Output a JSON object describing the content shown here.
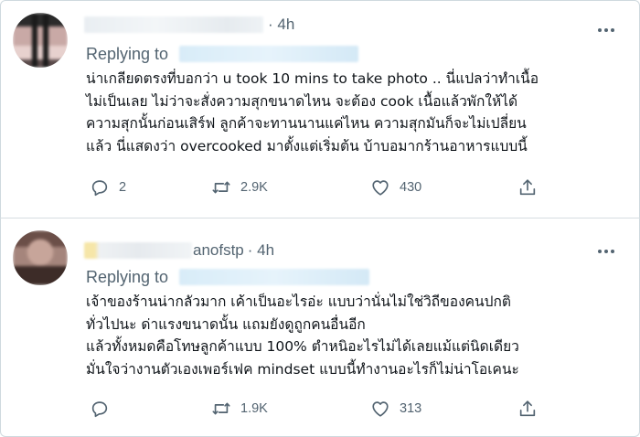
{
  "tweets": [
    {
      "handle_tail": "",
      "time": "· 4h",
      "replying_to_label": "Replying to",
      "lines": [
        "น่าเกลียดตรงที่บอกว่า u took 10 mins to take photo .. นี่แปลว่าทำเนื้อ",
        "ไม่เป็นเลย ไม่ว่าจะสั่งความสุกขนาดไหน จะต้อง cook เนื้อแล้วพักให้ได้",
        "ความสุกนั้นก่อนเสิร์ฟ ลูกค้าจะทานนานแค่ไหน ความสุกมันก็จะไม่เปลี่ยน",
        "แล้ว นี่แสดงว่า overcooked มาตั้งแต่เริ่มต้น บ้าบอมากร้านอาหารแบบนี้"
      ],
      "replies": "2",
      "retweets": "2.9K",
      "likes": "430"
    },
    {
      "handle_tail": "anofstp",
      "time": "· 4h",
      "replying_to_label": "Replying to",
      "lines": [
        "เจ้าของร้านน่ากลัวมาก เค้าเป็นอะไรอ่ะ แบบว่านั่นไม่ใช่วิถีของคนปกติ",
        "ทั่วไปนะ ด่าแรงขนาดนั้น แถมยังดูถูกคนอื่นอีก",
        "แล้วทั้งหมดคือโทษลูกค้าแบบ 100% ตำหนิอะไรไม่ได้เลยแม้แต่นิดเดียว",
        "มั่นใจว่างานตัวเองเพอร์เฟค mindset แบบนี้ทำงานอะไรก็ไม่น่าโอเคนะ"
      ],
      "replies": "",
      "retweets": "1.9K",
      "likes": "313"
    }
  ],
  "icons": {
    "reply": "reply-icon",
    "retweet": "retweet-icon",
    "like": "heart-icon",
    "share": "share-icon",
    "more": "more-icon"
  },
  "colors": {
    "text": "#0f1419",
    "muted": "#536471",
    "divider": "#d6dde1"
  }
}
